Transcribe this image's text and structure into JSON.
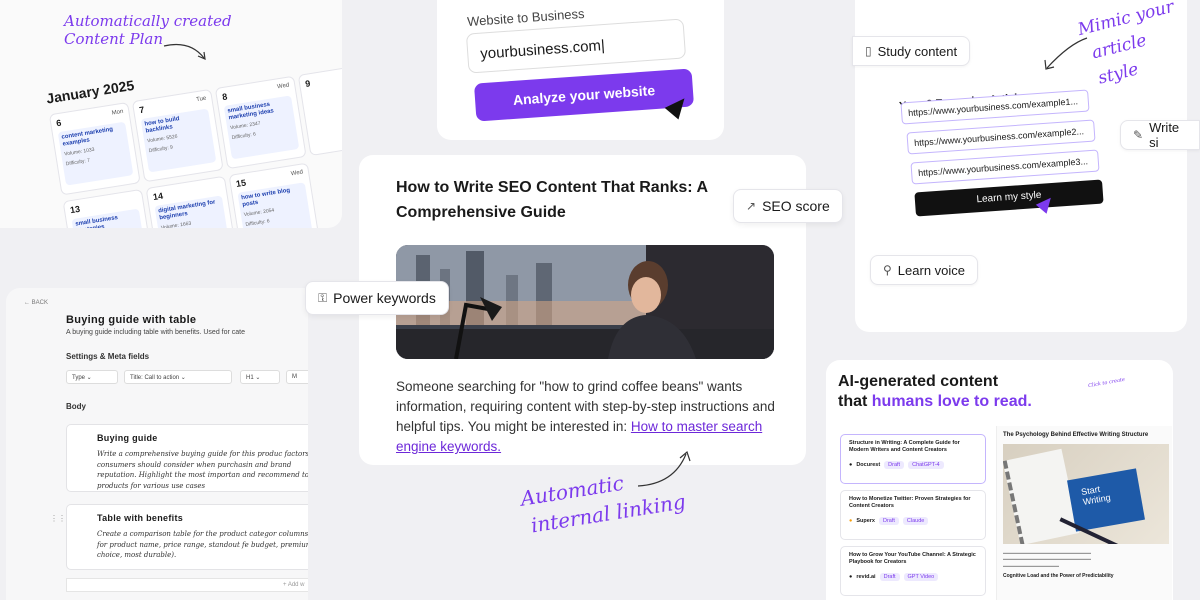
{
  "content_plan": {
    "annotation_line1": "Automatically created",
    "annotation_line2": "Content Plan",
    "month": "January 2025",
    "days": [
      {
        "num": "6",
        "dow": "Mon",
        "title": "content marketing examples",
        "stat1": "Volume: 1033",
        "stat2": "Difficulty: 7"
      },
      {
        "num": "7",
        "dow": "Tue",
        "title": "how to build backlinks",
        "stat1": "Volume: 5526",
        "stat2": "Difficulty: 9"
      },
      {
        "num": "8",
        "dow": "Wed",
        "title": "small business marketing ideas",
        "stat1": "Volume: 2347",
        "stat2": "Difficulty: 6"
      },
      {
        "num": "9",
        "dow": "",
        "title": "",
        "stat1": "",
        "stat2": ""
      },
      {
        "num": "13",
        "dow": "",
        "title": "small business strategies",
        "stat1": "",
        "stat2": ""
      },
      {
        "num": "14",
        "dow": "",
        "title": "digital marketing for beginners",
        "stat1": "Volume: 1663",
        "stat2": ""
      },
      {
        "num": "15",
        "dow": "Wed",
        "title": "how to write blog posts",
        "stat1": "Volume: 2054",
        "stat2": "Difficulty: 6"
      }
    ]
  },
  "website": {
    "label": "Website to Business",
    "value": "yourbusiness.com|",
    "button": "Analyze your website"
  },
  "mimic": {
    "study_pill": "Study content",
    "annotation_line1": "Mimic your",
    "annotation_line2": "article style",
    "examples_title": "Your  3 Examples  Articles",
    "urls": [
      "https://www.yourbusiness.com/example1...",
      "https://www.yourbusiness.com/example2...",
      "https://www.yourbusiness.com/example3..."
    ],
    "learn_button": "Learn my style",
    "write_pill": "Write si",
    "learn_voice_pill": "Learn voice"
  },
  "buying_guide": {
    "back": "BACK",
    "title": "Buying guide with table",
    "subtitle": "A buying guide including table with benefits. Used for cate",
    "settings_heading": "Settings & Meta fields",
    "selects": [
      "Type",
      "Title: Call to action",
      "H1",
      "M"
    ],
    "body_heading": "Body",
    "blocks": [
      {
        "heading": "Buying guide",
        "text": "Write a comprehensive buying guide for this produc factors consumers should consider when purchasin and brand reputation. Highlight the most importan and recommend top products for various use cases"
      },
      {
        "heading": "Table with benefits",
        "text": "Create a comparison table for the product categor columns for product name, price range, standout fe budget, premium choice, most durable)."
      }
    ],
    "add_label": "Add w"
  },
  "article": {
    "title": "How to Write SEO Content That Ranks: A Comprehensive Guide",
    "seo_pill": "SEO score",
    "keywords_pill": "Power keywords",
    "body": "Someone searching for \"how to grind coffee beans\" wants information, requiring content with step-by-step instructions and helpful tips. You might be interested in: ",
    "link": "How to master search engine keywords.",
    "annotation_line1": "Automatic",
    "annotation_line2": "internal linking"
  },
  "ai": {
    "heading_line1": "AI-generated content",
    "heading_line2_plain": "that ",
    "heading_line2_highlight": "humans love to read.",
    "click_note": "Click to create",
    "items": [
      {
        "title": "Structure in Writing: A Complete Guide for Modern Writers and Content Creators",
        "brand": "Docurest",
        "badge1": "Draft",
        "badge2": "ChatGPT-4"
      },
      {
        "title": "How to Monetize Twitter: Proven Strategies for Content Creators",
        "brand": "Superx",
        "badge1": "Draft",
        "badge2": "Claude"
      },
      {
        "title": "How to Grow Your YouTube Channel: A Strategic Playbook for Creators",
        "brand": "revid.ai",
        "badge1": "Draft",
        "badge2": "GPT Video"
      }
    ],
    "right_title": "The Psychology Behind Effective Writing Structure",
    "book_text": "Start Writing",
    "right_footer": "Cognitive Load and the Power of Predictability"
  }
}
